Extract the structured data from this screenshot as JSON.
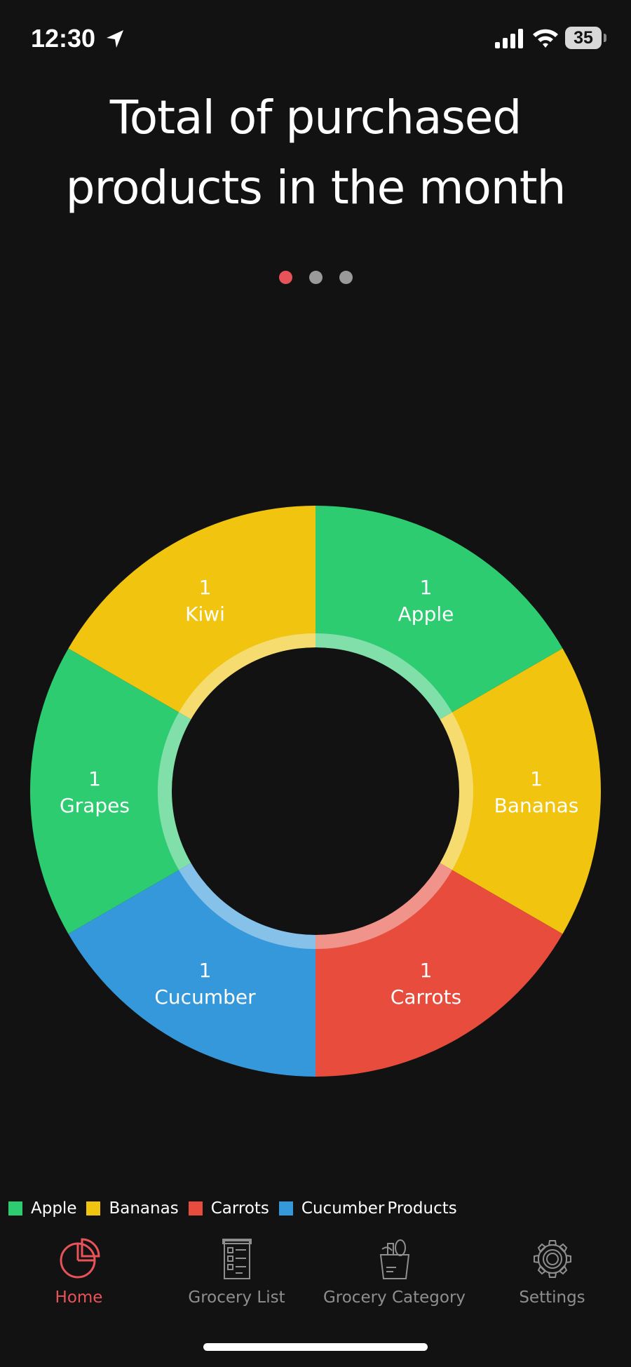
{
  "status_bar": {
    "time": "12:30",
    "battery": "35"
  },
  "title": "Total of purchased products in the month",
  "pager": {
    "count": 3,
    "active_index": 0
  },
  "colors": {
    "green": "#2ecc71",
    "yellow": "#f1c40f",
    "red": "#e74c3c",
    "blue": "#3498db",
    "accent": "#e8535a",
    "background": "#121212",
    "inactive": "#8e8e8e"
  },
  "chart_data": {
    "type": "pie",
    "title": "Total of purchased products in the month",
    "categories": [
      "Apple",
      "Bananas",
      "Carrots",
      "Cucumber",
      "Grapes",
      "Kiwi"
    ],
    "values": [
      1,
      1,
      1,
      1,
      1,
      1
    ],
    "slice_colors": [
      "#2ecc71",
      "#f1c40f",
      "#e74c3c",
      "#3498db",
      "#2ecc71",
      "#f1c40f"
    ],
    "donut": true,
    "legend_position": "bottom-left"
  },
  "legend": {
    "items": [
      {
        "label": "Apple",
        "color": "#2ecc71"
      },
      {
        "label": "Bananas",
        "color": "#f1c40f"
      },
      {
        "label": "Carrots",
        "color": "#e74c3c"
      },
      {
        "label": "Cucumber",
        "color": "#3498db"
      }
    ],
    "extra": "Products"
  },
  "tabs": [
    {
      "label": "Home",
      "icon": "pie-chart-icon",
      "active": true
    },
    {
      "label": "Grocery List",
      "icon": "checklist-icon",
      "active": false
    },
    {
      "label": "Grocery Category",
      "icon": "grocery-bag-icon",
      "active": false
    },
    {
      "label": "Settings",
      "icon": "gear-icon",
      "active": false
    }
  ]
}
